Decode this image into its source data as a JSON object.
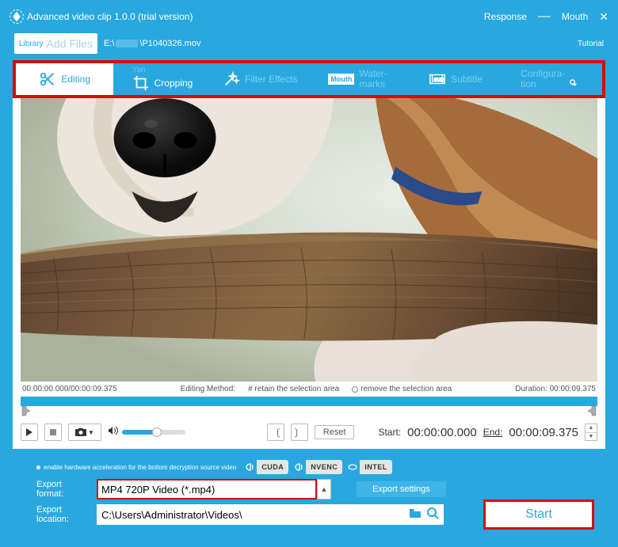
{
  "title": "Advanced video clip 1.0.0 (trial version)",
  "response_label": "Response",
  "mouth_label": "Mouth",
  "tutorial_label": "Tutorial",
  "library_label": "Library",
  "add_files_label": "Add Files",
  "file_path_prefix": "E:\\",
  "file_path_suffix": "\\P1040326.mov",
  "tabs": {
    "editing": {
      "label": "Editing",
      "active": true
    },
    "cropping": {
      "prefix": "Yan",
      "label": "Cropping"
    },
    "filter": {
      "label": "Filter Effects"
    },
    "watermark": {
      "prefix": "Mouth",
      "line1": "Water-",
      "line2": "marks"
    },
    "subtitle": {
      "label": "Subtitle"
    },
    "config": {
      "line1": "Configura-",
      "line2": "tion"
    }
  },
  "time_display": "00:00:00.000/00:00:09.375",
  "edit_method_label": "Editing Method:",
  "retain_option": "# retain the selection area",
  "remove_option": "remove the selection area",
  "duration_label": "Duration: 00:00:09.375",
  "reset_label": "Reset",
  "start_label": "Start:",
  "start_time": "00:00:00.000",
  "end_label": "End:",
  "end_time": "00:00:09.375",
  "hw_accel_label": "enable hardware acceleration for the bottom decryption source video",
  "badges": {
    "cuda": "CUDA",
    "nvenc": "NVENC",
    "intel": "INTEL"
  },
  "export_format_label": "Export format:",
  "export_format_value": "MP4 720P Video (*.mp4)",
  "export_settings_label": "Export settings",
  "export_location_label": "Export location:",
  "export_location_value": "C:\\Users\\Administrator\\Videos\\",
  "start_button": "Start"
}
